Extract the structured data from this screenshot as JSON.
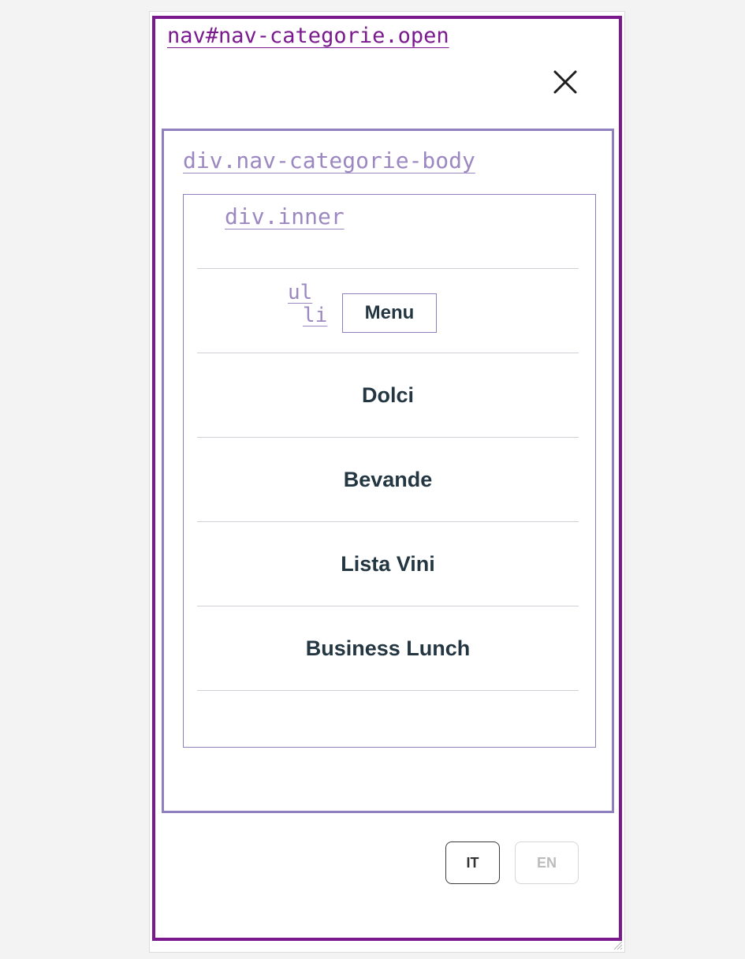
{
  "nav": {
    "tag_label": "nav#nav-categorie.open",
    "close_icon": "close-icon",
    "body": {
      "tag_label": "div.nav-categorie-body",
      "inner": {
        "tag_label": "div.inner",
        "ul_tag": "ul",
        "li_tag": "li",
        "items": [
          {
            "label": "Menu"
          },
          {
            "label": "Dolci"
          },
          {
            "label": "Bevande"
          },
          {
            "label": "Lista Vini"
          },
          {
            "label": "Business Lunch"
          }
        ]
      }
    },
    "languages": [
      {
        "label": "IT",
        "active": true
      },
      {
        "label": "EN",
        "active": false
      }
    ]
  },
  "colors": {
    "nav_border": "#7b1a8f",
    "body_border": "#8f7fbf",
    "tag_text": "#9c88c0",
    "item_text": "#233641",
    "divider": "#cfd3d8"
  }
}
